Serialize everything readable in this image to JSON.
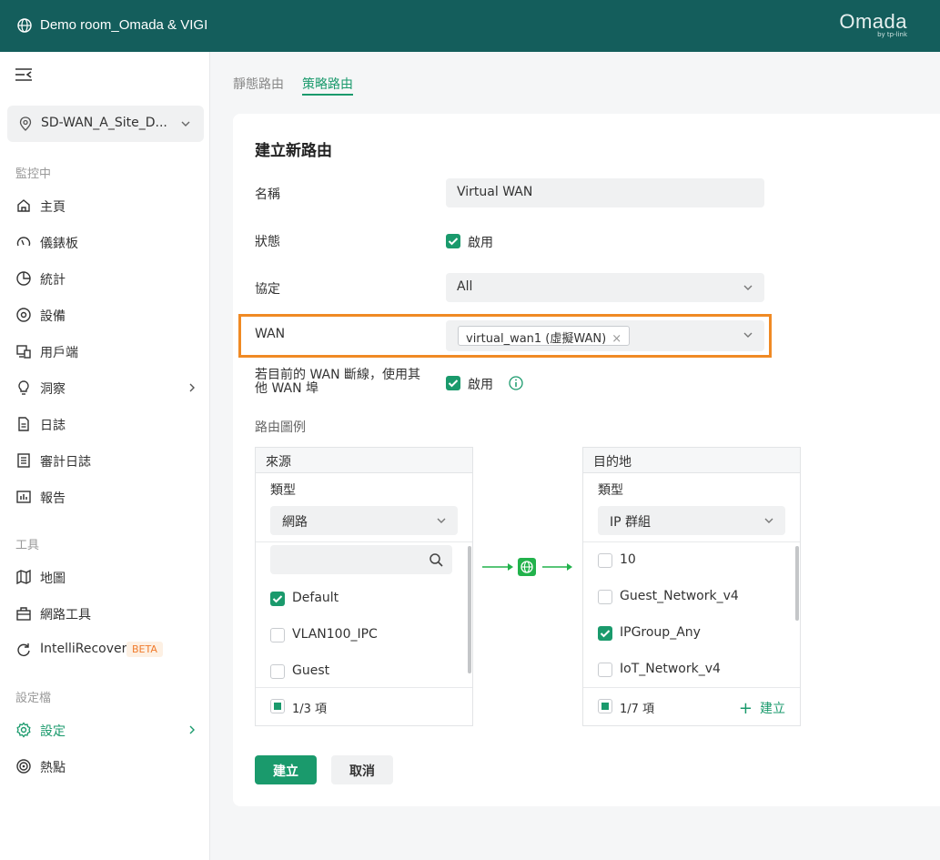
{
  "header": {
    "site_title": "Demo room_Omada & VIGI",
    "logo": "Omada",
    "logo_sub": "by tp-link"
  },
  "sidebar": {
    "site_name": "SD-WAN_A_Site_D...",
    "sections": {
      "monitoring": "監控中",
      "tools": "工具",
      "profile": "設定檔"
    },
    "items": {
      "home": "主頁",
      "dashboard": "儀錶板",
      "statistics": "統計",
      "devices": "設備",
      "clients": "用戶端",
      "insights": "洞察",
      "logs": "日誌",
      "audit_logs": "審計日誌",
      "reports": "報告",
      "map": "地圖",
      "network_tools": "網路工具",
      "intellirecover": "IntelliRecover",
      "settings": "設定",
      "hotspot": "熱點"
    },
    "beta_badge": "BETA"
  },
  "tabs": {
    "static": "靜態路由",
    "policy": "策略路由"
  },
  "form": {
    "title": "建立新路由",
    "name_label": "名稱",
    "name_value": "Virtual WAN",
    "status_label": "狀態",
    "status_enable": "啟用",
    "protocol_label": "協定",
    "protocol_value": "All",
    "wan_label": "WAN",
    "wan_tag": "virtual_wan1 (虛擬WAN)",
    "failover_label_1": "若目前的 WAN 斷線，使用其",
    "failover_label_2": "他 WAN 埠",
    "failover_enable": "啟用",
    "diagram_label": "路由圖例"
  },
  "source": {
    "title": "來源",
    "type_label": "類型",
    "type_value": "網路",
    "items": [
      "Default",
      "VLAN100_IPC",
      "Guest"
    ],
    "count": "1/3 項"
  },
  "destination": {
    "title": "目的地",
    "type_label": "類型",
    "type_value": "IP 群組",
    "items": [
      "10",
      "Guest_Network_v4",
      "IPGroup_Any",
      "IoT_Network_v4"
    ],
    "count": "1/7 項",
    "create": "建立"
  },
  "buttons": {
    "create": "建立",
    "cancel": "取消"
  },
  "colors": {
    "header_bg": "#145e5c",
    "accent": "#1a9a6c",
    "highlight": "#f08a24"
  }
}
